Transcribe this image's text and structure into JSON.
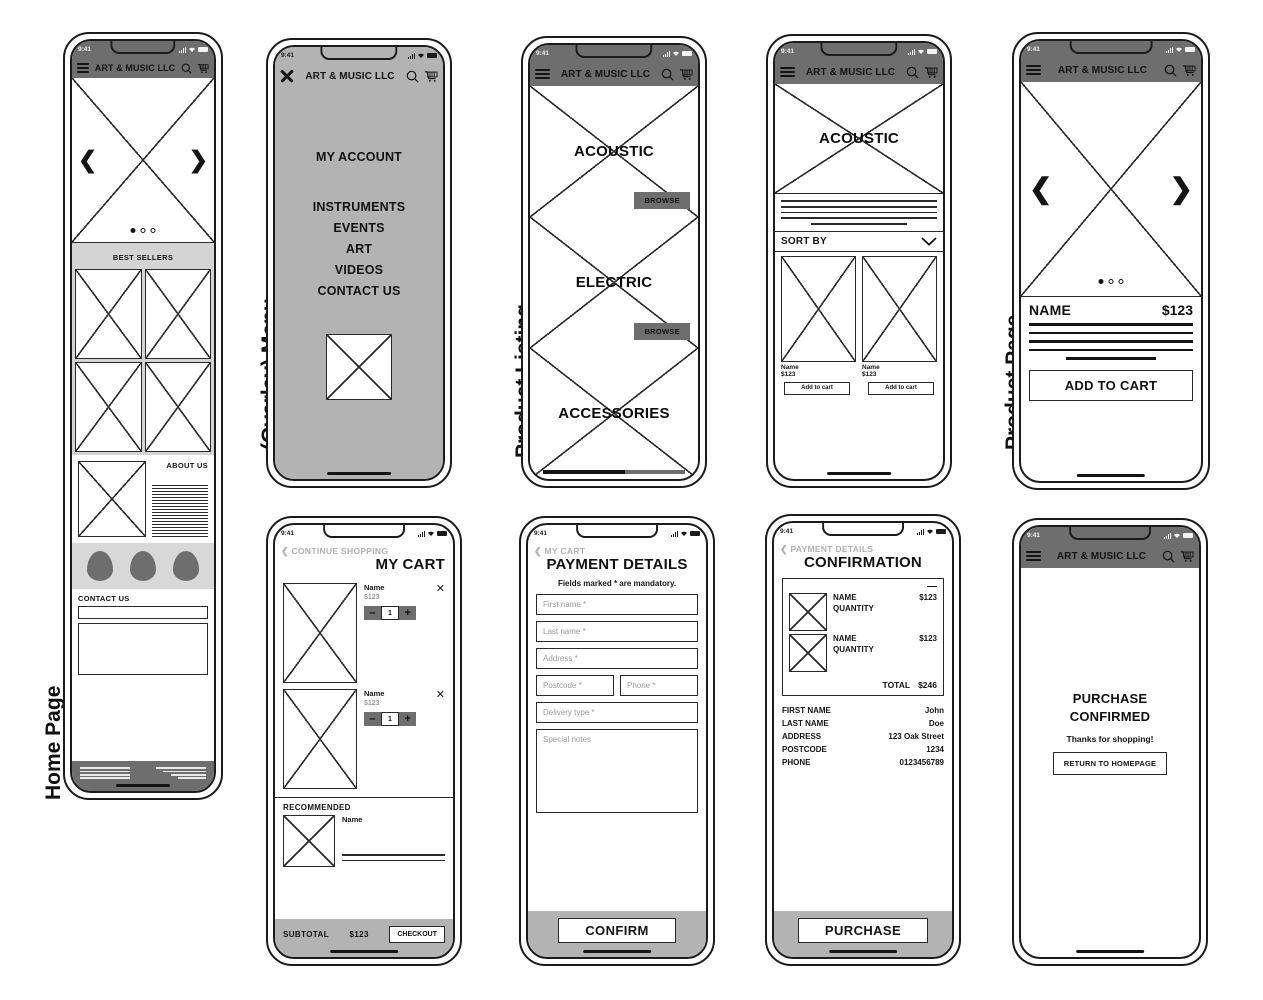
{
  "labels": {
    "home_page": "Home Page",
    "overlay_menu": "(Overlay) Menu",
    "product_listing": "Product Listing",
    "product_page": "Product Page"
  },
  "status_bar": {
    "time": "9:41"
  },
  "app_bar": {
    "brand": "ART & MUSIC LLC",
    "menu_icon": "hamburger-icon",
    "close_icon": "close-x-icon",
    "search_icon": "search-icon",
    "cart_icon": "shopping-cart-icon"
  },
  "home_page": {
    "carousel": {
      "prev": "❮",
      "next": "❯",
      "dots": 3,
      "active_dot": 0
    },
    "best_sellers_title": "BEST SELLERS",
    "about_title": "ABOUT US",
    "contact_title": "CONTACT US"
  },
  "overlay_menu": {
    "items": [
      {
        "label": "MY ACCOUNT"
      },
      {
        "label": "INSTRUMENTS"
      },
      {
        "label": "EVENTS"
      },
      {
        "label": "ART"
      },
      {
        "label": "VIDEOS"
      },
      {
        "label": "CONTACT US"
      }
    ]
  },
  "product_listing": {
    "categories": [
      {
        "label": "ACOUSTIC",
        "browse": "BROWSE"
      },
      {
        "label": "ELECTRIC",
        "browse": "BROWSE"
      },
      {
        "label": "ACCESSORIES",
        "browse": ""
      }
    ]
  },
  "category_page": {
    "hero_label": "ACOUSTIC",
    "sort_label": "SORT BY",
    "sort_icon": "chevron-down-icon",
    "products": [
      {
        "name": "Name",
        "price": "$123",
        "add": "Add to cart"
      },
      {
        "name": "Name",
        "price": "$123",
        "add": "Add to cart"
      }
    ]
  },
  "product_page": {
    "carousel": {
      "prev": "❮",
      "next": "❯",
      "dots": 3,
      "active_dot": 0
    },
    "name": "NAME",
    "price": "$123",
    "add_to_cart": "ADD TO CART"
  },
  "cart_page": {
    "back": "CONTINUE SHOPPING",
    "title": "MY CART",
    "items": [
      {
        "name": "Name",
        "price": "$123",
        "qty": "1",
        "minus": "–",
        "plus": "+",
        "remove": "✕"
      },
      {
        "name": "Name",
        "price": "$123",
        "qty": "1",
        "minus": "–",
        "plus": "+",
        "remove": "✕"
      }
    ],
    "recommended_title": "RECOMMENDED",
    "recommended_name": "Name",
    "subtotal_label": "SUBTOTAL",
    "subtotal_value": "$123",
    "checkout": "CHECKOUT"
  },
  "payment_page": {
    "back": "MY CART",
    "title": "PAYMENT DETAILS",
    "note": "Fields marked * are mandatory.",
    "fields": [
      {
        "placeholder": "First name *"
      },
      {
        "placeholder": "Last name *"
      },
      {
        "placeholder": "Address *"
      },
      {
        "placeholder": "Postcode *"
      },
      {
        "placeholder": "Phone *"
      },
      {
        "placeholder": "Delivery type *"
      },
      {
        "placeholder": "Special notes"
      }
    ],
    "confirm": "CONFIRM"
  },
  "confirmation_page": {
    "back": "PAYMENT DETAILS",
    "title": "CONFIRMATION",
    "collapse_icon": "minus-icon",
    "items": [
      {
        "name": "NAME",
        "qty_label": "QUANTITY",
        "price": "$123"
      },
      {
        "name": "NAME",
        "qty_label": "QUANTITY",
        "price": "$123"
      }
    ],
    "total_label": "TOTAL",
    "total_value": "$246",
    "details": [
      {
        "key": "FIRST NAME",
        "value": "John"
      },
      {
        "key": "LAST NAME",
        "value": "Doe"
      },
      {
        "key": "ADDRESS",
        "value": "123 Oak Street"
      },
      {
        "key": "POSTCODE",
        "value": "1234"
      },
      {
        "key": "PHONE",
        "value": "0123456789"
      }
    ],
    "purchase": "PURCHASE"
  },
  "purchase_confirmed_page": {
    "title_line1": "PURCHASE",
    "title_line2": "CONFIRMED",
    "subtitle": "Thanks for shopping!",
    "return_button": "RETURN TO HOMEPAGE"
  },
  "colors": {
    "ink": "#1b1b1b",
    "dark_bar": "#6e6e6e",
    "gray_bar": "#b3b3b3",
    "light_gray": "#d4d4d4"
  }
}
